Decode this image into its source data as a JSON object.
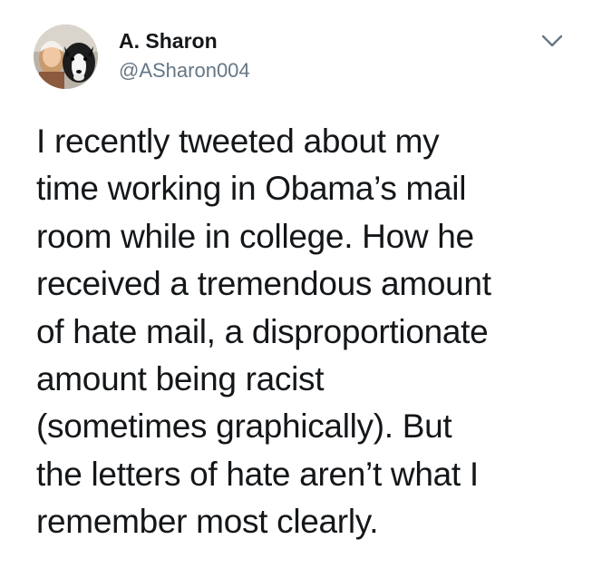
{
  "tweet": {
    "author": {
      "display_name": "A. Sharon",
      "handle": "@ASharon004",
      "avatar_icon": "profile-photo-with-dog"
    },
    "menu": {
      "icon": "chevron-down-icon"
    },
    "text_lines": [
      "I recently tweeted about my",
      "time working in Obama’s mail",
      "room while in college. How he",
      "received a tremendous amount",
      "of hate mail, a disproportionate",
      "amount being racist",
      "(sometimes graphically). But",
      "the letters of hate aren’t what I",
      "remember most clearly."
    ],
    "colors": {
      "text": "#14171a",
      "secondary": "#657786",
      "background": "#ffffff"
    }
  }
}
